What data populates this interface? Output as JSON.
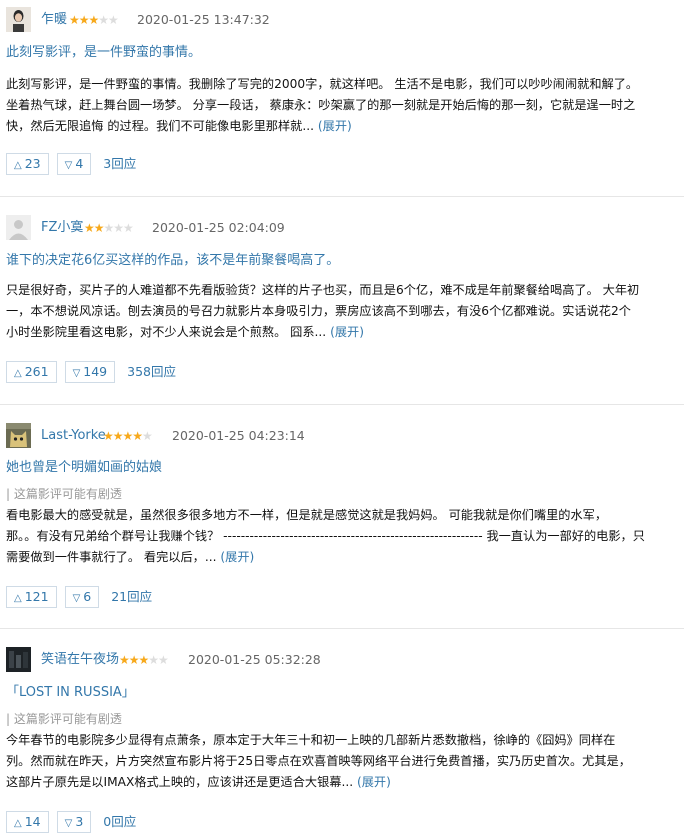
{
  "colors": {
    "link": "#3377aa",
    "star_on": "#f7a91c",
    "star_off": "#dddddd",
    "spoiler": "#999999",
    "divider": "#e6e6e6"
  },
  "reviews": [
    {
      "username": "乍暖",
      "rating_stars": 3,
      "stars_text": {
        "on": "★★★",
        "off": "★★"
      },
      "timestamp": "2020-01-25 13:47:32",
      "title": "此刻写影评，是一件野蛮的事情。",
      "spoiler": "",
      "body_lines": [
        "此刻写影评，是一件野蛮的事情。我删除了写完的2000字，就这样吧。 生活不是电影，我们可以吵吵闹闹就和解了。",
        "坐着热气球，赶上舞台圆一场梦。 分享一段话， 蔡康永：吵架赢了的那一刻就是开始后悔的那一刻，它就是逞一时之",
        "快，然后无限追悔 的过程。我们不可能像电影里那样就... "
      ],
      "expand_label": "(展开)",
      "useful_count": "23",
      "useless_count": "4",
      "replies_label": "3回应",
      "avatar_icon": "avatar-portrait-icon"
    },
    {
      "username": "FZ小寞",
      "rating_stars": 2,
      "stars_text": {
        "on": "★★",
        "off": "★★★"
      },
      "timestamp": "2020-01-25 02:04:09",
      "title": "谁下的决定花6亿买这样的作品，该不是年前聚餐喝高了。",
      "spoiler": "",
      "body_lines": [
        "只是很好奇，买片子的人难道都不先看版验货？这样的片子也买，而且是6个亿，难不成是年前聚餐给喝高了。 大年初",
        "一，本不想说风凉话。刨去演员的号召力就影片本身吸引力，票房应该高不到哪去，有没6个亿都难说。实话说花2个",
        "小时坐影院里看这电影，对不少人来说会是个煎熬。 囧系... "
      ],
      "expand_label": "(展开)",
      "useful_count": "261",
      "useless_count": "149",
      "replies_label": "358回应",
      "avatar_icon": "default-avatar-icon"
    },
    {
      "username": "Last-Yorke",
      "rating_stars": 4,
      "stars_text": {
        "on": "★★★★",
        "off": "★"
      },
      "timestamp": "2020-01-25 04:23:14",
      "title": "她也曾是个明媚如画的姑娘",
      "spoiler": "| 这篇影评可能有剧透",
      "body_lines": [
        "看电影最大的感受就是，虽然很多很多地方不一样，但是就是感觉这就是我妈妈。 可能我就是你们嘴里的水军，",
        "那。。有没有兄弟给个群号让我赚个钱？ ----------------------------------------------------------- 我一直认为一部好的电影，只",
        "需要做到一件事就行了。 看完以后，... "
      ],
      "expand_label": "(展开)",
      "useful_count": "121",
      "useless_count": "6",
      "replies_label": "21回应",
      "avatar_icon": "cat-avatar-icon"
    },
    {
      "username": "笑语在午夜场",
      "rating_stars": 3,
      "stars_text": {
        "on": "★★★",
        "off": "★★"
      },
      "timestamp": "2020-01-25 05:32:28",
      "title": "「LOST IN RUSSIA」",
      "spoiler": "| 这篇影评可能有剧透",
      "body_lines": [
        "今年春节的电影院多少显得有点萧条，原本定于大年三十和初一上映的几部新片悉数撤档，徐峥的《囧妈》同样在",
        "列。然而就在昨天，片方突然宣布影片将于25日零点在欢喜首映等网络平台进行免费首播，实乃历史首次。尤其是，",
        "这部片子原先是以IMAX格式上映的，应该讲还是更适合大银幕... "
      ],
      "expand_label": "(展开)",
      "useful_count": "14",
      "useless_count": "3",
      "replies_label": "0回应",
      "avatar_icon": "dark-scene-avatar-icon"
    }
  ],
  "vote_icons": {
    "up": "△",
    "down": "▽"
  }
}
